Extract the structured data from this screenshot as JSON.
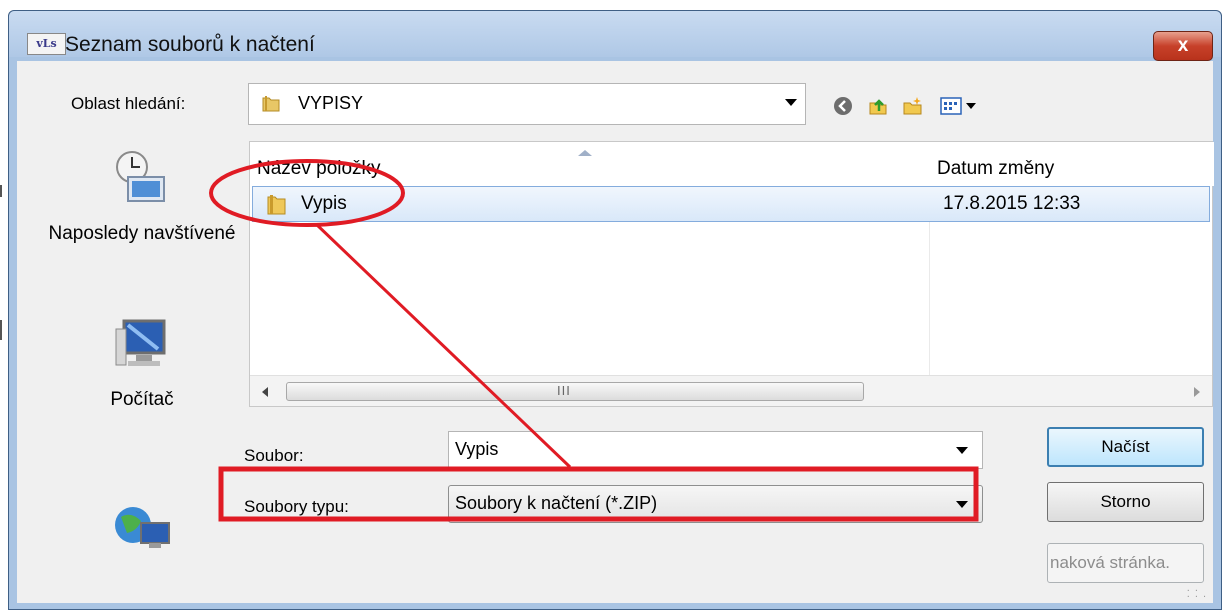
{
  "window": {
    "title": "Seznam souborů k načtení",
    "app_icon_text": "vLs",
    "close_label": "x"
  },
  "lookin": {
    "label": "Oblast hledání:",
    "value": "VYPISY"
  },
  "toolbar": {
    "icons": [
      "back-icon",
      "up-folder-icon",
      "new-folder-icon",
      "view-menu-icon"
    ]
  },
  "places": [
    {
      "label": "Naposledy navštívené",
      "icon": "recent-places-icon"
    },
    {
      "label": "Počítač",
      "icon": "computer-icon"
    },
    {
      "label": "",
      "icon": "network-icon"
    }
  ],
  "filelist": {
    "columns": [
      "Název položky",
      "Datum změny"
    ],
    "rows": [
      {
        "name": "Vypis",
        "date": "17.8.2015 12:33",
        "icon": "folder-icon"
      }
    ],
    "scroll_grip": "III"
  },
  "file_name": {
    "label": "Soubor:",
    "value": "Vypis"
  },
  "file_type": {
    "label": "Soubory typu:",
    "value": "Soubory k načtení (*.ZIP)"
  },
  "buttons": {
    "open": "Načíst",
    "cancel": "Storno",
    "homepage": "naková stránka."
  },
  "colors": {
    "annotation": "#e01b24",
    "selection": "#d9e8f9",
    "title_bar": "#b9cfe9"
  }
}
